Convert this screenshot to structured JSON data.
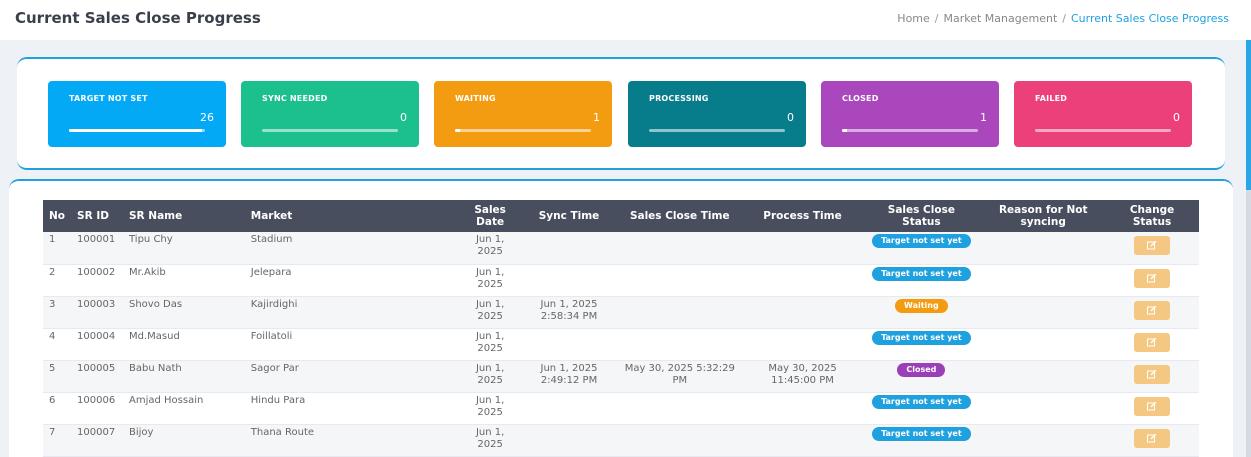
{
  "header": {
    "title": "Current Sales Close Progress",
    "breadcrumb": [
      "Home",
      "Market Management",
      "Current Sales Close Progress"
    ]
  },
  "colors": {
    "accent": "#1fa1e0",
    "target_not_set": "#03a9f4",
    "sync_needed": "#1cbf8e",
    "waiting": "#f39c12",
    "processing": "#077c8a",
    "closed": "#ab47bc",
    "failed": "#ec407a"
  },
  "stats": [
    {
      "label": "TARGET NOT SET",
      "value": "26",
      "progress": 0.98
    },
    {
      "label": "SYNC NEEDED",
      "value": "0",
      "progress": 0
    },
    {
      "label": "WAITING",
      "value": "1",
      "progress": 0.04
    },
    {
      "label": "PROCESSING",
      "value": "0",
      "progress": 0
    },
    {
      "label": "CLOSED",
      "value": "1",
      "progress": 0.04
    },
    {
      "label": "FAILED",
      "value": "0",
      "progress": 0
    }
  ],
  "table": {
    "columns": [
      "No",
      "SR ID",
      "SR Name",
      "Market",
      "Sales Date",
      "Sync Time",
      "Sales Close Time",
      "Process Time",
      "Sales Close Status",
      "Reason for Not syncing",
      "Change Status"
    ],
    "rows": [
      {
        "no": "1",
        "sr_id": "100001",
        "sr_name": "Tipu Chy",
        "market": "Stadium",
        "sales_date": "Jun 1, 2025",
        "sync_time": "",
        "close_time": "",
        "process_time": "",
        "status": "Target not set yet",
        "status_type": "target",
        "reason": ""
      },
      {
        "no": "2",
        "sr_id": "100002",
        "sr_name": "Mr.Akib",
        "market": "Jelepara",
        "sales_date": "Jun 1, 2025",
        "sync_time": "",
        "close_time": "",
        "process_time": "",
        "status": "Target not set yet",
        "status_type": "target",
        "reason": ""
      },
      {
        "no": "3",
        "sr_id": "100003",
        "sr_name": "Shovo Das",
        "market": "Kajirdighi",
        "sales_date": "Jun 1, 2025",
        "sync_time": "Jun 1, 2025 2:58:34 PM",
        "close_time": "",
        "process_time": "",
        "status": "Waiting",
        "status_type": "waiting",
        "reason": ""
      },
      {
        "no": "4",
        "sr_id": "100004",
        "sr_name": "Md.Masud",
        "market": "Foillatoli",
        "sales_date": "Jun 1, 2025",
        "sync_time": "",
        "close_time": "",
        "process_time": "",
        "status": "Target not set yet",
        "status_type": "target",
        "reason": ""
      },
      {
        "no": "5",
        "sr_id": "100005",
        "sr_name": "Babu Nath",
        "market": "Sagor Par",
        "sales_date": "Jun 1, 2025",
        "sync_time": "Jun 1, 2025 2:49:12 PM",
        "close_time": "May 30, 2025 5:32:29 PM",
        "process_time": "May 30, 2025 11:45:00 PM",
        "status": "Closed",
        "status_type": "closed",
        "reason": ""
      },
      {
        "no": "6",
        "sr_id": "100006",
        "sr_name": "Amjad Hossain",
        "market": "Hindu Para",
        "sales_date": "Jun 1, 2025",
        "sync_time": "",
        "close_time": "",
        "process_time": "",
        "status": "Target not set yet",
        "status_type": "target",
        "reason": ""
      },
      {
        "no": "7",
        "sr_id": "100007",
        "sr_name": "Bijoy",
        "market": "Thana Route",
        "sales_date": "Jun 1, 2025",
        "sync_time": "",
        "close_time": "",
        "process_time": "",
        "status": "Target not set yet",
        "status_type": "target",
        "reason": ""
      }
    ]
  }
}
